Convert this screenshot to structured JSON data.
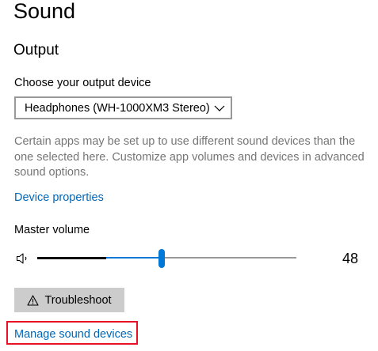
{
  "page": {
    "title": "Sound"
  },
  "output": {
    "section_title": "Output",
    "choose_device_label": "Choose your output device",
    "selected_device": "Headphones (WH-1000XM3 Stereo)",
    "help_text": "Certain apps may be set up to use different sound devices than the one selected here. Customize app volumes and devices in advanced sound options.",
    "device_properties_link": "Device properties",
    "master_volume_label": "Master volume",
    "volume_level": 48,
    "volume_text": "48",
    "troubleshoot_label": "Troubleshoot",
    "manage_devices_link": "Manage sound devices"
  },
  "icons": {
    "speaker": "speaker-volume-icon",
    "chevron": "chevron-down-icon",
    "warning": "warning-icon"
  },
  "colors": {
    "accent": "#0078d7",
    "link": "#0067b8",
    "secondary_text": "#767676",
    "button_bg": "#cccccc",
    "highlight_border": "#e81123"
  }
}
